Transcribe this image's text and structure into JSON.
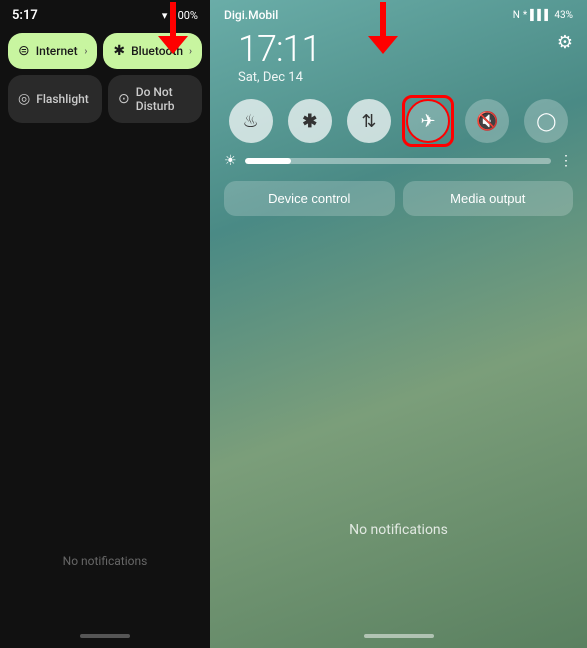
{
  "left": {
    "status": {
      "time": "5:17",
      "date": "Sat, Dec 14",
      "wifi": "▼",
      "battery": "100%"
    },
    "tiles": {
      "row1": [
        {
          "icon": "wifi",
          "label": "Internet",
          "active": true,
          "chevron": true
        },
        {
          "icon": "bluetooth",
          "label": "Bluetooth",
          "active": true,
          "chevron": true
        }
      ],
      "row2": [
        {
          "icon": "flashlight",
          "label": "Flashlight",
          "active": false
        },
        {
          "icon": "donotdisturb",
          "label": "Do Not Disturb",
          "active": false
        }
      ]
    },
    "no_notifications": "No notifications"
  },
  "right": {
    "status": {
      "carrier": "Digi.Mobil",
      "nfc_icon": "N",
      "bluetooth_icon": "*",
      "battery": "43%"
    },
    "time": "17:11",
    "date": "Sat, Dec 14",
    "quick_icons": [
      {
        "name": "wifi",
        "symbol": "⚛",
        "active": true
      },
      {
        "name": "bluetooth",
        "symbol": "⚡",
        "active": true
      },
      {
        "name": "data-transfer",
        "symbol": "⇅",
        "active": true
      },
      {
        "name": "airplane-mode",
        "symbol": "✈",
        "active": false
      },
      {
        "name": "mute",
        "symbol": "🔇",
        "active": false
      },
      {
        "name": "minus",
        "symbol": "−",
        "active": false
      }
    ],
    "device_control": "Device control",
    "media_output": "Media output",
    "no_notifications": "No notifications"
  },
  "arrows": {
    "left_label": "pointing to Bluetooth",
    "right_label": "pointing to airplane mode"
  }
}
